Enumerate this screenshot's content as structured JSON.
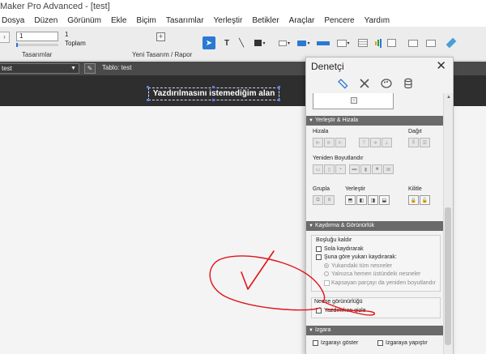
{
  "window": {
    "title": "Maker Pro Advanced - [test]"
  },
  "menu": [
    "Dosya",
    "Düzen",
    "Görünüm",
    "Ekle",
    "Biçim",
    "Tasarımlar",
    "Yerleştir",
    "Betikler",
    "Araçlar",
    "Pencere",
    "Yardım"
  ],
  "toolbar": {
    "record_value": "1",
    "record_count": "1",
    "total_label": "Toplam",
    "layouts_label": "Tasarımlar",
    "new_layout_label": "Yeni Tasarım / Rapor"
  },
  "layout_bar": {
    "layout_name": "test",
    "table_label": "Tablo: test"
  },
  "canvas": {
    "header_field_text": "Yazdırılmasını istemediğim alan"
  },
  "inspector": {
    "title": "Denetçi",
    "tabs": [
      "position-tab",
      "styles-tab",
      "appearance-tab",
      "data-tab"
    ],
    "active_tab": 0,
    "arrange_section": "Yerleştir & Hizala",
    "align_label": "Hizala",
    "distribute_label": "Dağıt",
    "resize_label": "Yeniden Boyutlandır",
    "group_label": "Grupla",
    "arrange_label": "Yerleştir",
    "lock_label": "Kilitle",
    "sliding_section": "Kaydırma & Görünürlük",
    "remove_blank_label": "Boşluğu kaldır",
    "slide_left_label": "Sola kaydırarak",
    "slide_up_label": "Şuna göre yukarı kaydırarak:",
    "all_above_label": "Yukarıdaki tüm nesneler",
    "only_directly_above_label": "Yalnızca hemen üstündeki nesneler",
    "resize_enclosing_label": "Kapsayan parçayı da yeniden boyutlandır",
    "object_visibility_label": "Nesne görünürlüğü",
    "hide_when_printing_label": "Yazdırırken gizle",
    "grid_section": "Izgara",
    "show_grid_label": "Izgarayı göster",
    "snap_grid_label": "Izgaraya yapıştır"
  },
  "colors": {
    "header_band": "#2e2e2e",
    "accent": "#2a79d3",
    "annotation": "#e0141a"
  }
}
